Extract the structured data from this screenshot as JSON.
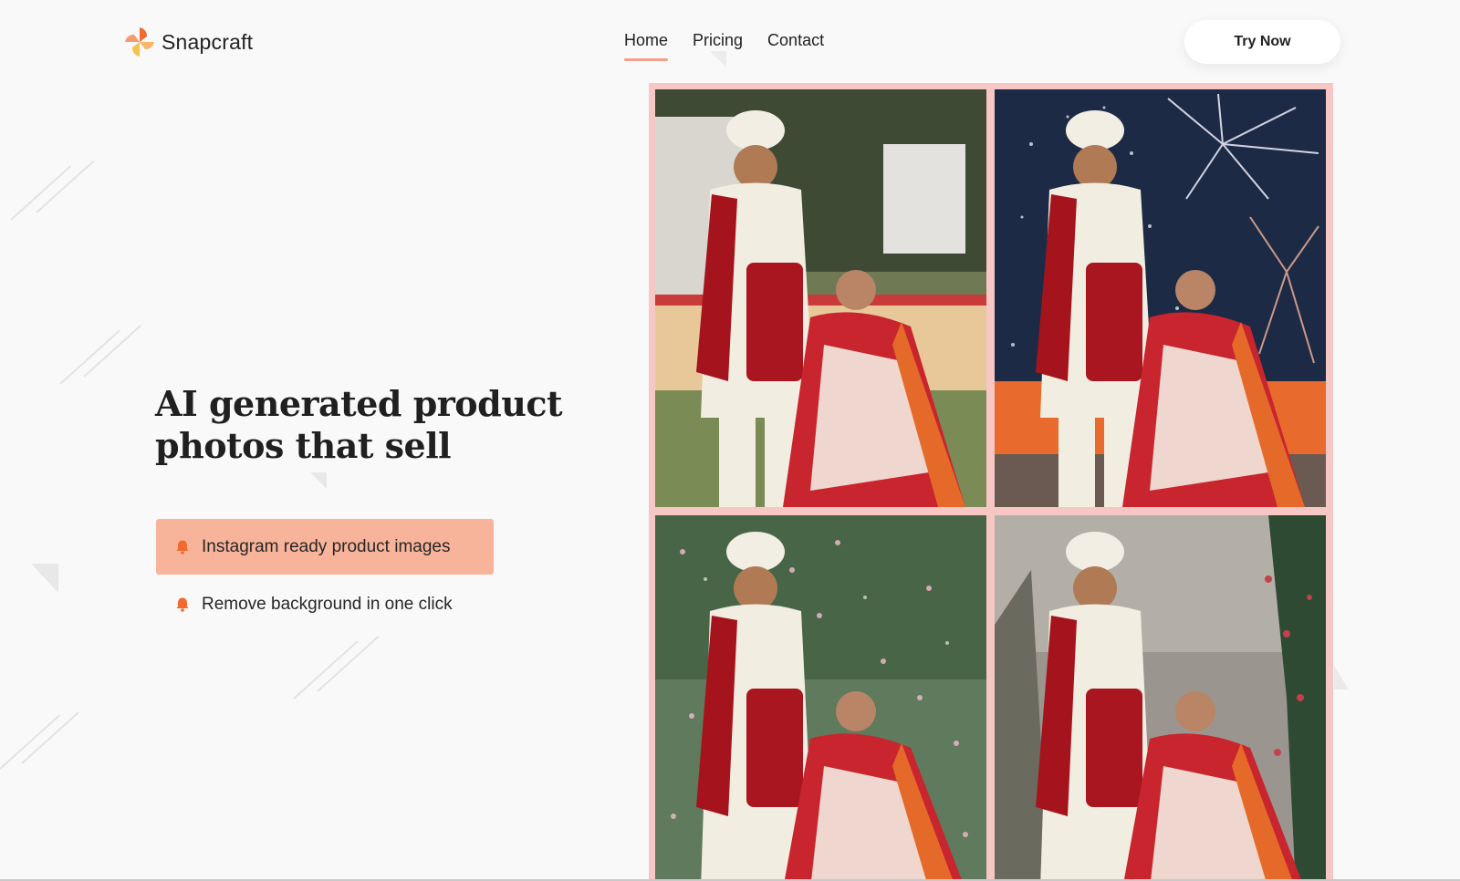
{
  "brand": {
    "name": "Snapcraft"
  },
  "nav": {
    "items": [
      {
        "label": "Home",
        "active": true
      },
      {
        "label": "Pricing",
        "active": false
      },
      {
        "label": "Contact",
        "active": false
      }
    ]
  },
  "header": {
    "cta_label": "Try Now"
  },
  "hero": {
    "headline_line1": "AI generated product",
    "headline_line2": "photos that sell",
    "features": [
      {
        "label": "Instagram ready product images",
        "icon": "bell-icon",
        "active": true
      },
      {
        "label": "Remove background in one click",
        "icon": "bell-icon",
        "active": false
      }
    ]
  },
  "gallery": {
    "photos": [
      {
        "scene": "garden-venue",
        "subject": "couple-in-wedding-attire"
      },
      {
        "scene": "fireworks-night",
        "subject": "couple-in-wedding-attire"
      },
      {
        "scene": "flower-petals",
        "subject": "couple-in-wedding-attire"
      },
      {
        "scene": "forest-trees",
        "subject": "couple-in-wedding-attire"
      }
    ]
  },
  "colors": {
    "accent": "#f8b49a",
    "nav_underline": "#f3a08c",
    "frame": "#f6c7c4",
    "icon": "#f26a2e",
    "background": "#f9f9f9"
  }
}
